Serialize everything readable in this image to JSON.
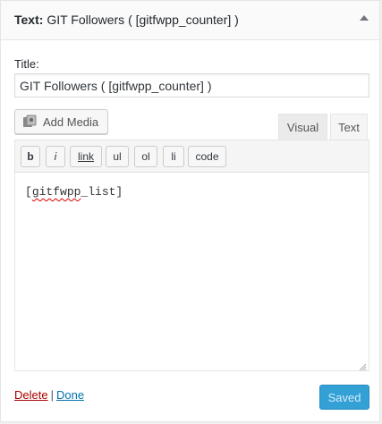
{
  "widget": {
    "title_prefix": "Text",
    "title_separator": ":",
    "title_name": "GIT Followers ( [gitfwpp_counter] )",
    "toggle_icon": "arrow-up-icon"
  },
  "form": {
    "title_label": "Title:",
    "title_value": "GIT Followers ( [gitfwpp_counter] )"
  },
  "editor": {
    "add_media_label": "Add Media",
    "add_media_icon": "media-icon",
    "tabs": [
      "Visual",
      "Text"
    ],
    "active_tab": "Text",
    "quicktags": [
      "b",
      "i",
      "link",
      "ul",
      "ol",
      "li",
      "code"
    ],
    "content_open": "[",
    "content_misspelled": "gitfwpp",
    "content_rest": "_list]"
  },
  "footer": {
    "delete_label": "Delete",
    "separator": "|",
    "done_label": "Done",
    "saved_label": "Saved"
  },
  "colors": {
    "delete_link": "#a00",
    "done_link": "#0073aa",
    "saved_button": "#33a0d6"
  }
}
